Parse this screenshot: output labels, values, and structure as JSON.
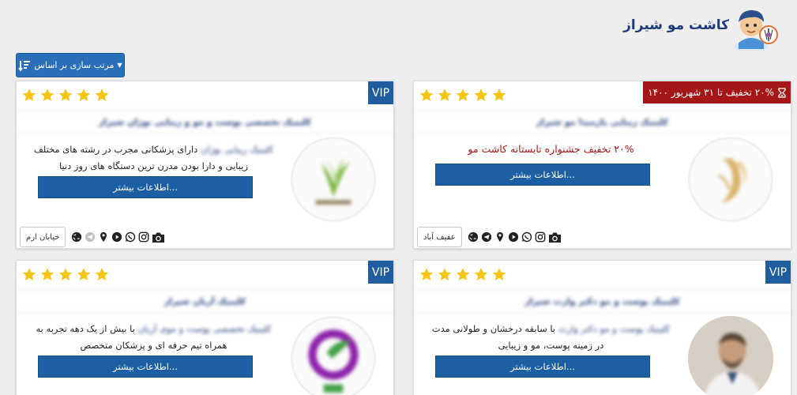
{
  "header": {
    "site_title": "کاشت مو شیراز"
  },
  "toolbar": {
    "sort_label": "مرتب سازی بر اساس"
  },
  "cards": [
    {
      "badge": "VIP",
      "rating": 5,
      "title": "کلینیک تخصصی پوست و مو و زیبایی بوژان شیراز",
      "desc_blur": "کلینیک زیبایی بوژان",
      "desc_text": "دارای پزشکانی مجرب در رشته های مختلف زیبایی و دارا بودن مدرن ترین دستگاه های روز دنیا",
      "more_label": "اطلاعات بیشتر...",
      "area": "خیابان ارم"
    },
    {
      "discount": "۲۰% تخفیف تا ۳۱ شهریور ۱۴۰۰",
      "rating": 5,
      "title": "کلینیک زیبایی پارمیدا مو شیراز",
      "promo": "۲۰% تخفیف جشنواره تابستانه کاشت مو",
      "more_label": "اطلاعات بیشتر...",
      "area": "عفیف آباد"
    },
    {
      "badge": "VIP",
      "rating": 5,
      "title": "کلینیک آریان شیراز",
      "desc_blur": "کلینیک تخصصی پوست و موی آریان",
      "desc_text": "با بیش از یک دهه تجربه به همراه تیم حرفه ای و پزشکان متخصص",
      "more_label": "اطلاعات بیشتر..."
    },
    {
      "badge": "VIP",
      "rating": 5,
      "title": "کلینیک پوست و مو دکتر وارث شیراز",
      "desc_blur": "کلینیک پوست و مو دکتر وارث",
      "desc_text": "با سابقه درخشان و طولانی مدت در زمینه پوست، مو و زیبایی",
      "more_label": "اطلاعات بیشتر..."
    }
  ],
  "colors": {
    "accent": "#1c5fa3",
    "title": "#1f3c7a",
    "discount": "#a51717",
    "star": "#f5c518"
  },
  "icons": [
    "camera-icon",
    "instagram-icon",
    "whatsapp-icon",
    "play-icon",
    "location-icon",
    "telegram-icon",
    "globe-icon",
    "sort-icon",
    "hourglass-icon"
  ]
}
